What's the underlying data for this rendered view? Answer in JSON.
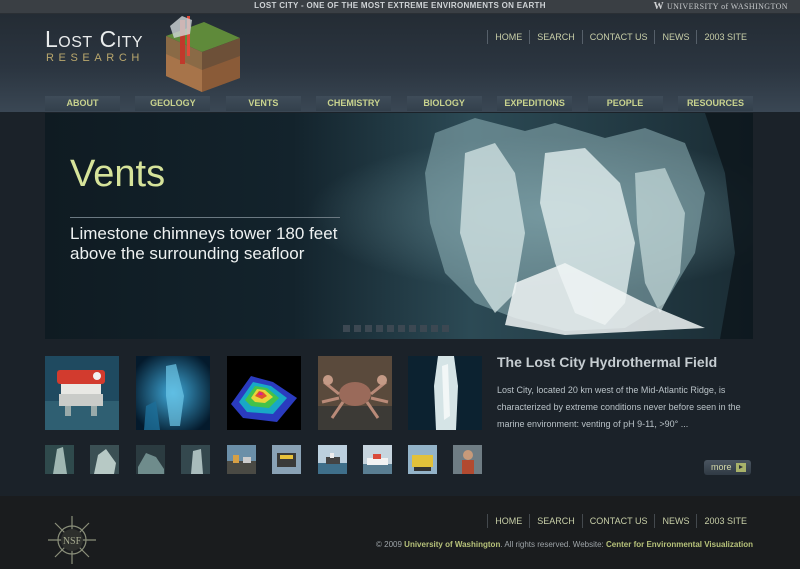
{
  "topstrip": {
    "tagline": "LOST CITY -  ONE OF THE MOST EXTREME ENVIRONMENTS ON EARTH",
    "uw_mark": "W",
    "uw_text": "UNIVERSITY of WASHINGTON"
  },
  "logo": {
    "title": "Lost City",
    "subtitle": "RESEARCH"
  },
  "top_nav": [
    "HOME",
    "SEARCH",
    "CONTACT US",
    "NEWS",
    "2003 SITE"
  ],
  "main_nav": [
    "ABOUT",
    "GEOLOGY",
    "VENTS",
    "CHEMISTRY",
    "BIOLOGY",
    "EXPEDITIONS",
    "PEOPLE",
    "RESOURCES"
  ],
  "hero": {
    "title": "Vents",
    "caption_line1": "Limestone chimneys tower 180 feet",
    "caption_line2": "above the surrounding seafloor"
  },
  "article": {
    "title": "The Lost City Hydrothermal Field",
    "body": "Lost City, located 20 km west of the Mid-Atlantic Ridge, is characterized by extreme conditions never before seen in the marine environment: venting of pH 9-11, >90° ...",
    "more_label": "more"
  },
  "thumbnails": [
    "rov-robot",
    "blue-chimney",
    "bathymetry-map",
    "crab",
    "white-chimney"
  ],
  "small_thumbnails": [
    "chimney-1",
    "chimney-2",
    "chimney-3",
    "chimney-4",
    "ship-deck",
    "rov-deck",
    "ship-at-sea",
    "ship-2",
    "submersible",
    "scientist"
  ],
  "footer": {
    "nsf": "NSF",
    "nav": [
      "HOME",
      "SEARCH",
      "CONTACT US",
      "NEWS",
      "2003 SITE"
    ],
    "copyright_prefix": "© 2009 ",
    "uw_link": "University of Washington",
    "copyright_mid": ". All rights reserved. Website: ",
    "cev_link": "Center for Environmental Visualization"
  },
  "colors": {
    "accent_green": "#c9d38e",
    "hero_title": "#d6e39a",
    "gold": "#b9a76d"
  }
}
